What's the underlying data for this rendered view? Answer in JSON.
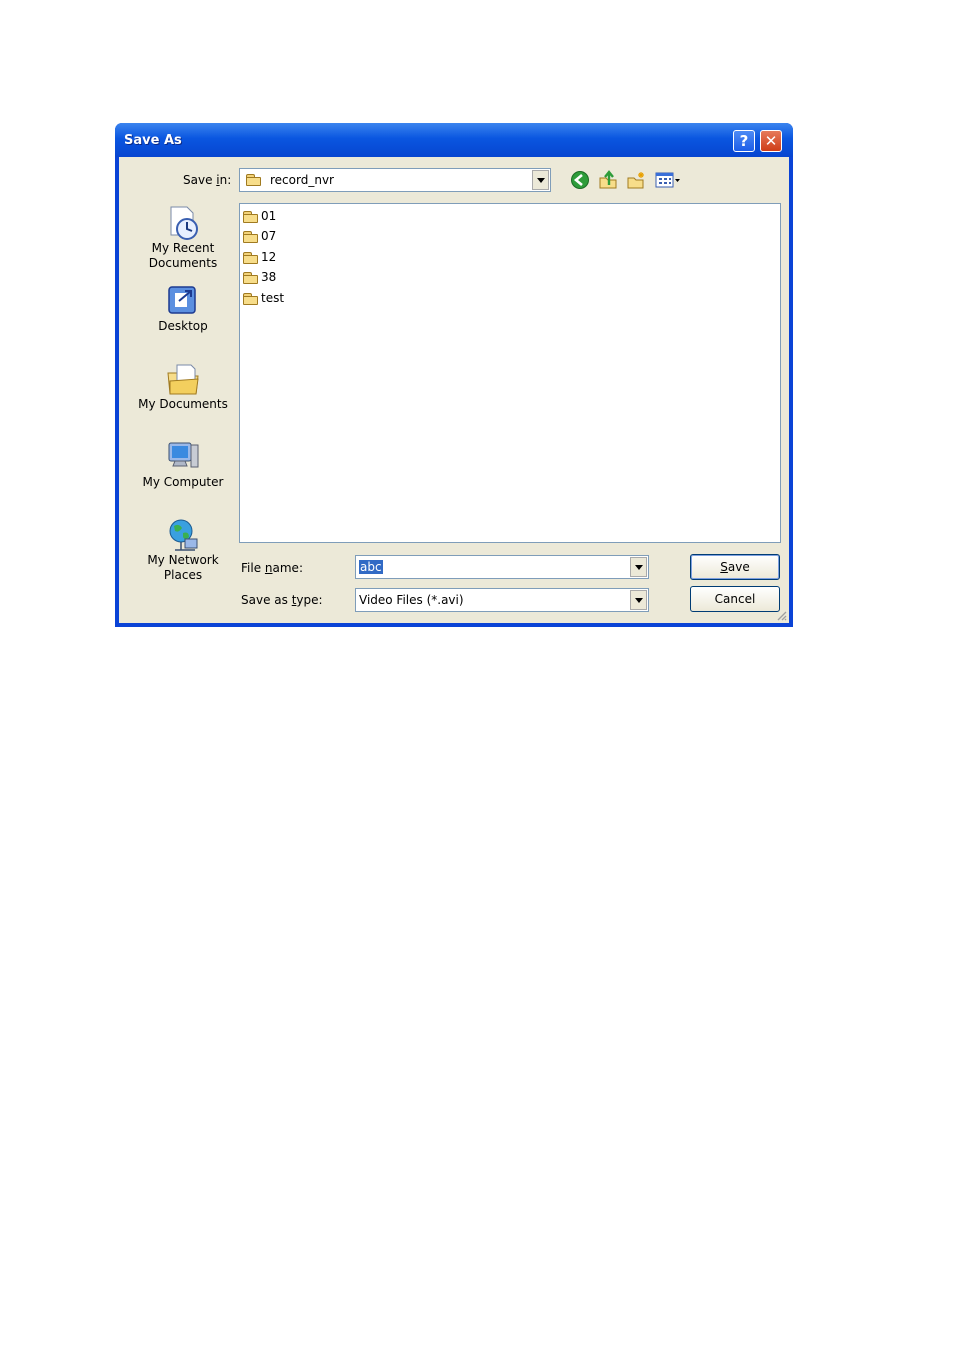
{
  "window": {
    "title": "Save As",
    "help_glyph": "?",
    "close_glyph": "✕"
  },
  "save_in": {
    "label_pre": "Save ",
    "label_access": "i",
    "label_post": "n:",
    "value": "record_nvr"
  },
  "toolbar": {
    "back_icon": "back-icon",
    "up_icon": "up-folder-icon",
    "new_folder_icon": "new-folder-icon",
    "views_icon": "views-menu-icon"
  },
  "places": [
    {
      "line1": "My Recent",
      "line2": "Documents",
      "icon": "recent-documents-icon"
    },
    {
      "line1": "Desktop",
      "line2": "",
      "icon": "desktop-icon"
    },
    {
      "line1": "My Documents",
      "line2": "",
      "icon": "my-documents-icon"
    },
    {
      "line1": "My Computer",
      "line2": "",
      "icon": "my-computer-icon"
    },
    {
      "line1": "My Network",
      "line2": "Places",
      "icon": "network-places-icon"
    }
  ],
  "files": [
    "01",
    "07",
    "12",
    "38",
    "test"
  ],
  "file_name": {
    "label_pre": "File ",
    "label_access": "n",
    "label_post": "ame:",
    "value": "abc"
  },
  "save_type": {
    "label_pre": "Save as ",
    "label_access": "t",
    "label_post": "ype:",
    "value": "Video Files (*.avi)"
  },
  "buttons": {
    "save_access": "S",
    "save_rest": "ave",
    "cancel": "Cancel"
  },
  "colors": {
    "title_bar": "#0a56e0",
    "client_bg": "#ece9d8",
    "selection": "#316ac5"
  }
}
